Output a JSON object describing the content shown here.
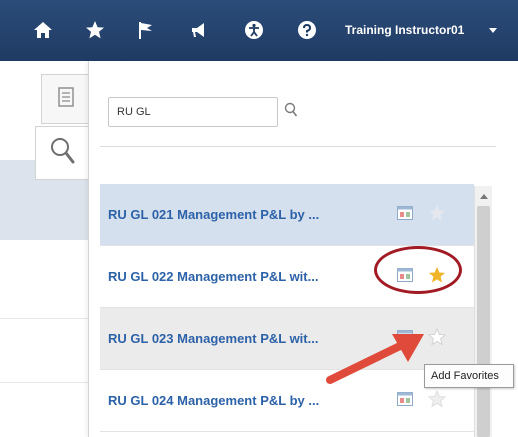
{
  "header": {
    "user_name": "Training Instructor01",
    "icons": [
      "home-icon",
      "star-icon",
      "flag-icon",
      "megaphone-icon",
      "accessibility-icon",
      "help-icon"
    ],
    "background_color": "#1f3b63"
  },
  "side_tabs": {
    "icons": [
      "document-icon",
      "search-icon"
    ],
    "active": "search"
  },
  "search": {
    "value": "RU GL"
  },
  "results": [
    {
      "label": "RU GL 021 Management P&L by ...",
      "favorite": false,
      "selected": true
    },
    {
      "label": "RU GL 022 Management P&L wit...",
      "favorite": true,
      "selected": false
    },
    {
      "label": "RU GL 023 Management P&L wit...",
      "favorite": false,
      "selected": false,
      "hovered": true
    },
    {
      "label": "RU GL 024 Management P&L by ...",
      "favorite": false,
      "selected": false
    }
  ],
  "tooltip": {
    "text": "Add Favorites"
  },
  "colors": {
    "link": "#2d62a8",
    "selected_row": "#d5e0ee",
    "hover_row": "#ebebeb",
    "favorite_star": "#f0b429",
    "annotation_red": "#e04a3a",
    "annotation_circle": "#a11a24"
  }
}
